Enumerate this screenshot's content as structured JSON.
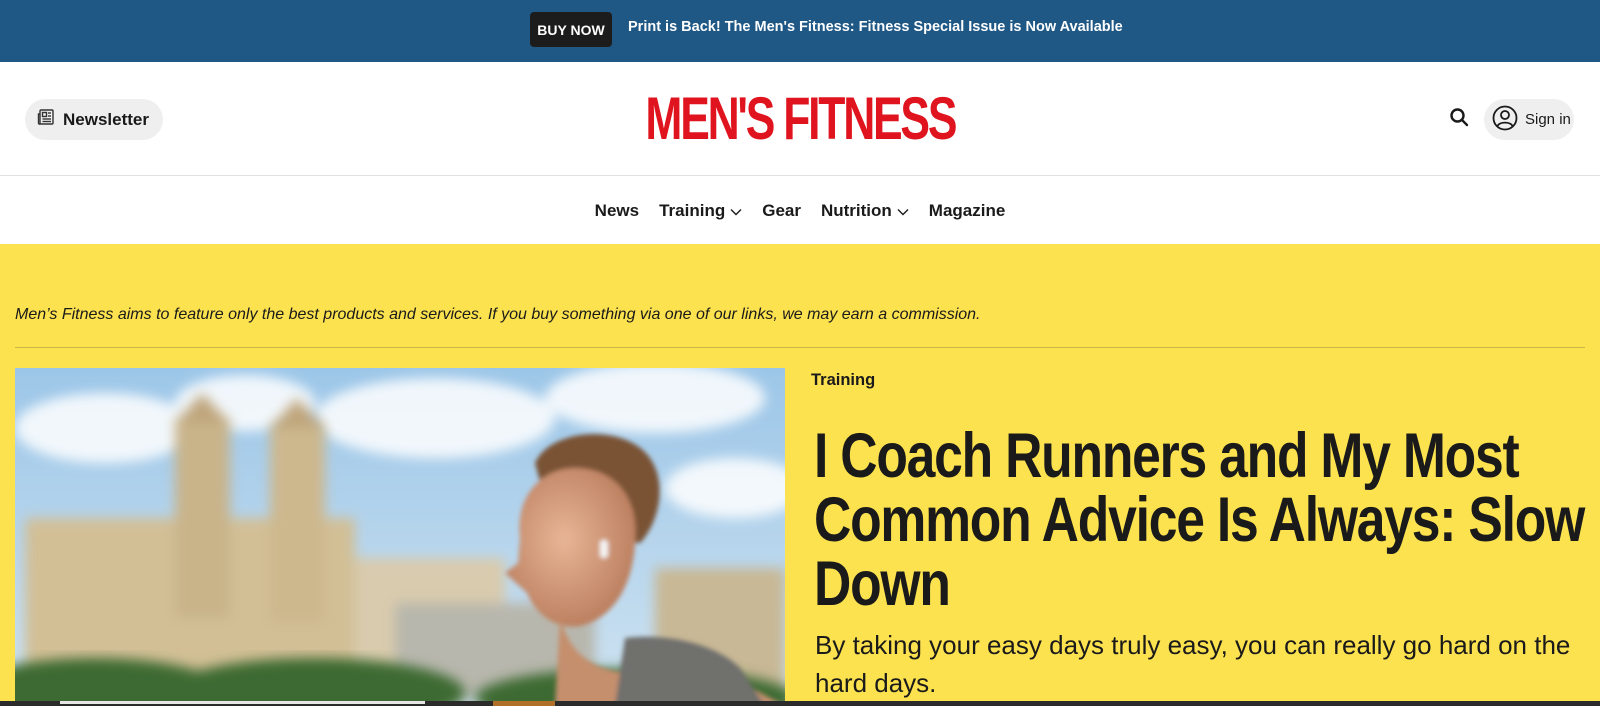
{
  "promo": {
    "button_label": "BUY NOW",
    "message": "Print is Back! The Men's Fitness: Fitness Special Issue is Now Available",
    "background_color": "#1f5785"
  },
  "header": {
    "newsletter_label": "Newsletter",
    "logo_text": "MEN'S FITNESS",
    "logo_color": "#e0141e",
    "signin_label": "Sign in"
  },
  "nav": {
    "items": [
      {
        "label": "News",
        "has_dropdown": false
      },
      {
        "label": "Training",
        "has_dropdown": true
      },
      {
        "label": "Gear",
        "has_dropdown": false
      },
      {
        "label": "Nutrition",
        "has_dropdown": true
      },
      {
        "label": "Magazine",
        "has_dropdown": false
      }
    ]
  },
  "main": {
    "background_color": "#fde24f",
    "disclaimer": "Men’s Fitness aims to feature only the best products and services. If you buy something via one of our links, we may earn a commission.",
    "article": {
      "category": "Training",
      "headline_lines": [
        "I Coach Runners and My Most",
        "Common Advice Is Always: Slow",
        "Down"
      ],
      "dek": "By taking your easy days truly easy, you can really go hard on the hard days."
    }
  }
}
